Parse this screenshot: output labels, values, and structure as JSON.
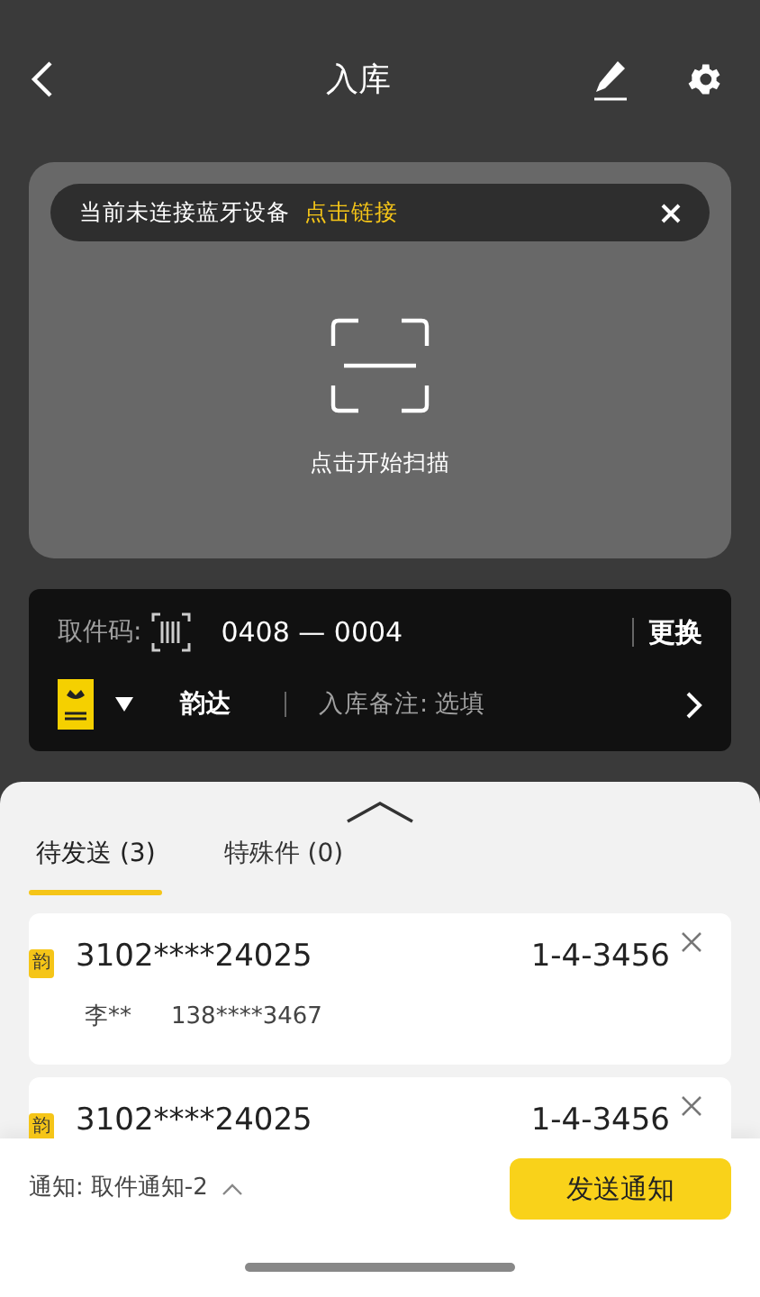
{
  "header": {
    "title": "入库"
  },
  "bluetooth_banner": {
    "message": "当前未连接蓝牙设备",
    "link": "点击链接"
  },
  "scanner": {
    "hint": "点击开始扫描"
  },
  "pickup": {
    "label": "取件码:",
    "code_prefix": "0408",
    "separator": "—",
    "code_suffix": "0004",
    "change": "更换",
    "courier": "韵达",
    "remark_label": "入库备注:",
    "remark_placeholder": "选填"
  },
  "tabs": [
    {
      "label": "待发送 (3)",
      "selected": true
    },
    {
      "label": "特殊件 (0)",
      "selected": false
    }
  ],
  "parcels": [
    {
      "badge": "韵",
      "tracking": "3102****24025",
      "shelf": "1-4-3456",
      "name": "李**",
      "phone": "138****3467"
    },
    {
      "badge": "韵",
      "tracking": "3102****24025",
      "shelf": "1-4-3456"
    }
  ],
  "footer": {
    "notice_label": "通知:",
    "notice_value": "取件通知-2",
    "send": "发送通知"
  }
}
